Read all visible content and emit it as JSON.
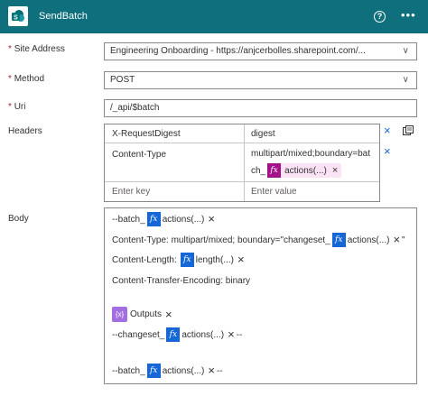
{
  "header": {
    "title": "SendBatch",
    "help_icon": "?",
    "more_icon": "•••",
    "bg_color": "#0f6f7c"
  },
  "fields": {
    "site_address": {
      "label": "Site Address",
      "required": "*",
      "value": "Engineering Onboarding - https://anjcerbolles.sharepoint.com/..."
    },
    "method": {
      "label": "Method",
      "required": "*",
      "value": "POST"
    },
    "uri": {
      "label": "Uri",
      "required": "*",
      "value": "/_api/$batch"
    }
  },
  "headers": {
    "label": "Headers",
    "rows": [
      {
        "key": "X-RequestDigest",
        "value": "digest"
      },
      {
        "key": "Content-Type",
        "value_line1": "multipart/mixed;boundary=bat",
        "value_line2": "ch_",
        "token": "actions(...)"
      }
    ],
    "key_placeholder": "Enter key",
    "value_placeholder": "Enter value"
  },
  "body": {
    "label": "Body",
    "lines": {
      "l1_prefix": "--batch_",
      "l1_token": "actions(...)",
      "l2_prefix": "Content-Type: multipart/mixed; boundary=\"changeset_",
      "l2_token": "actions(...)",
      "l2_suffix": "\"",
      "l3_prefix": "Content-Length:",
      "l3_token": "length(...)",
      "l4": "Content-Transfer-Encoding: binary",
      "l5_token": "Outputs",
      "l6_prefix": "--changeset_",
      "l6_token": "actions(...)",
      "l6_suffix": "--",
      "l7_prefix": "--batch_",
      "l7_token": "actions(...)",
      "l7_suffix": "--"
    }
  },
  "icons": {
    "fx": "fx",
    "close": "×",
    "chevron": "∨",
    "outputs": "{x}"
  }
}
